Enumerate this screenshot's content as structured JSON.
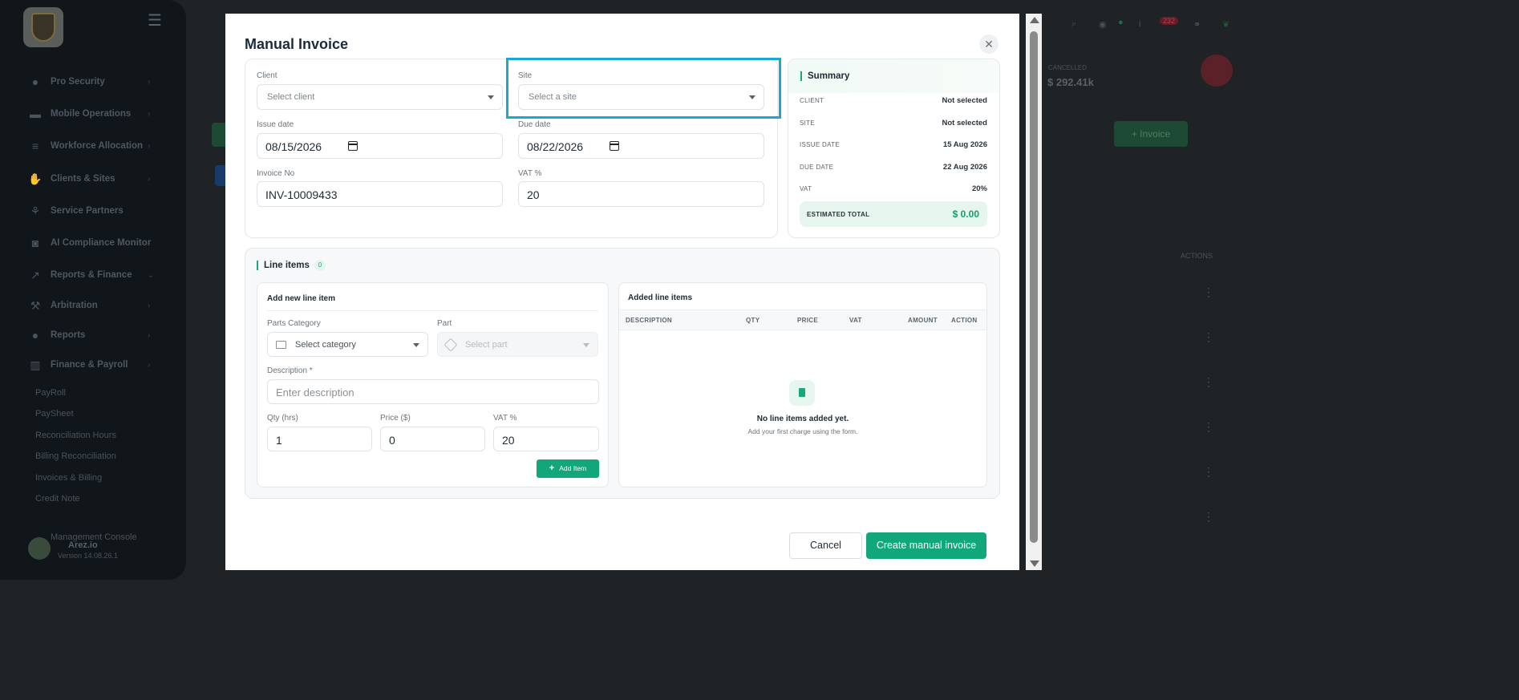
{
  "sidebar": {
    "items": [
      {
        "label": "Pro Security",
        "icon": "user-shield-icon"
      },
      {
        "label": "Mobile Operations",
        "icon": "car-icon"
      },
      {
        "label": "Workforce Allocation",
        "icon": "list-icon"
      },
      {
        "label": "Clients & Sites",
        "icon": "handshake-icon"
      },
      {
        "label": "Service Partners",
        "icon": "partners-icon"
      },
      {
        "label": "AI Compliance Monitor",
        "icon": "robot-icon"
      },
      {
        "label": "Reports & Finance",
        "icon": "chart-icon"
      },
      {
        "label": "Arbitration",
        "icon": "gavel-icon"
      },
      {
        "label": "Reports",
        "icon": "user-report-icon"
      },
      {
        "label": "Finance & Payroll",
        "icon": "bar-chart-icon"
      }
    ],
    "sub_items": [
      "PayRoll",
      "PaySheet",
      "Reconciliation Hours",
      "Billing Reconciliation",
      "Invoices & Billing",
      "Credit Note"
    ],
    "footer": {
      "console": "Management Console",
      "brand": "Arez.io",
      "version": "Version 14.08.26.1"
    }
  },
  "background": {
    "stat_label": "CANCELLED",
    "stat_value": "$ 292.41k",
    "invoice_button": "+ Invoice",
    "actions_header": "ACTIONS",
    "notif_count": "232"
  },
  "modal": {
    "title": "Manual Invoice",
    "form": {
      "client_label": "Client",
      "client_placeholder": "Select client",
      "site_label": "Site",
      "site_placeholder": "Select a site",
      "issue_date_label": "Issue date",
      "issue_date_value": "08/15/2026",
      "due_date_label": "Due date",
      "due_date_value": "08/22/2026",
      "invoice_no_label": "Invoice No",
      "invoice_no_value": "INV-10009433",
      "vat_label": "VAT %",
      "vat_value": "20"
    },
    "summary": {
      "title": "Summary",
      "rows": [
        {
          "key": "CLIENT",
          "value": "Not selected"
        },
        {
          "key": "SITE",
          "value": "Not selected"
        },
        {
          "key": "ISSUE DATE",
          "value": "15 Aug 2026"
        },
        {
          "key": "DUE DATE",
          "value": "22 Aug 2026"
        },
        {
          "key": "VAT",
          "value": "20%"
        }
      ],
      "total_label": "ESTIMATED TOTAL",
      "total_value": "$ 0.00"
    },
    "line_items": {
      "title": "Line items",
      "count": "0",
      "add": {
        "title": "Add new line item",
        "parts_category_label": "Parts Category",
        "parts_category_placeholder": "Select category",
        "part_label": "Part",
        "part_placeholder": "Select part",
        "description_label": "Description *",
        "description_placeholder": "Enter description",
        "qty_label": "Qty (hrs)",
        "qty_value": "1",
        "price_label": "Price ($)",
        "price_value": "0",
        "vat_label": "VAT %",
        "vat_value": "20",
        "add_button": "Add Item"
      },
      "added": {
        "title": "Added line items",
        "columns": [
          "DESCRIPTION",
          "QTY",
          "PRICE",
          "VAT",
          "AMOUNT",
          "ACTION"
        ],
        "empty_title": "No line items added yet.",
        "empty_subtitle": "Add your first charge using the form."
      }
    },
    "buttons": {
      "cancel": "Cancel",
      "create": "Create manual invoice"
    }
  }
}
